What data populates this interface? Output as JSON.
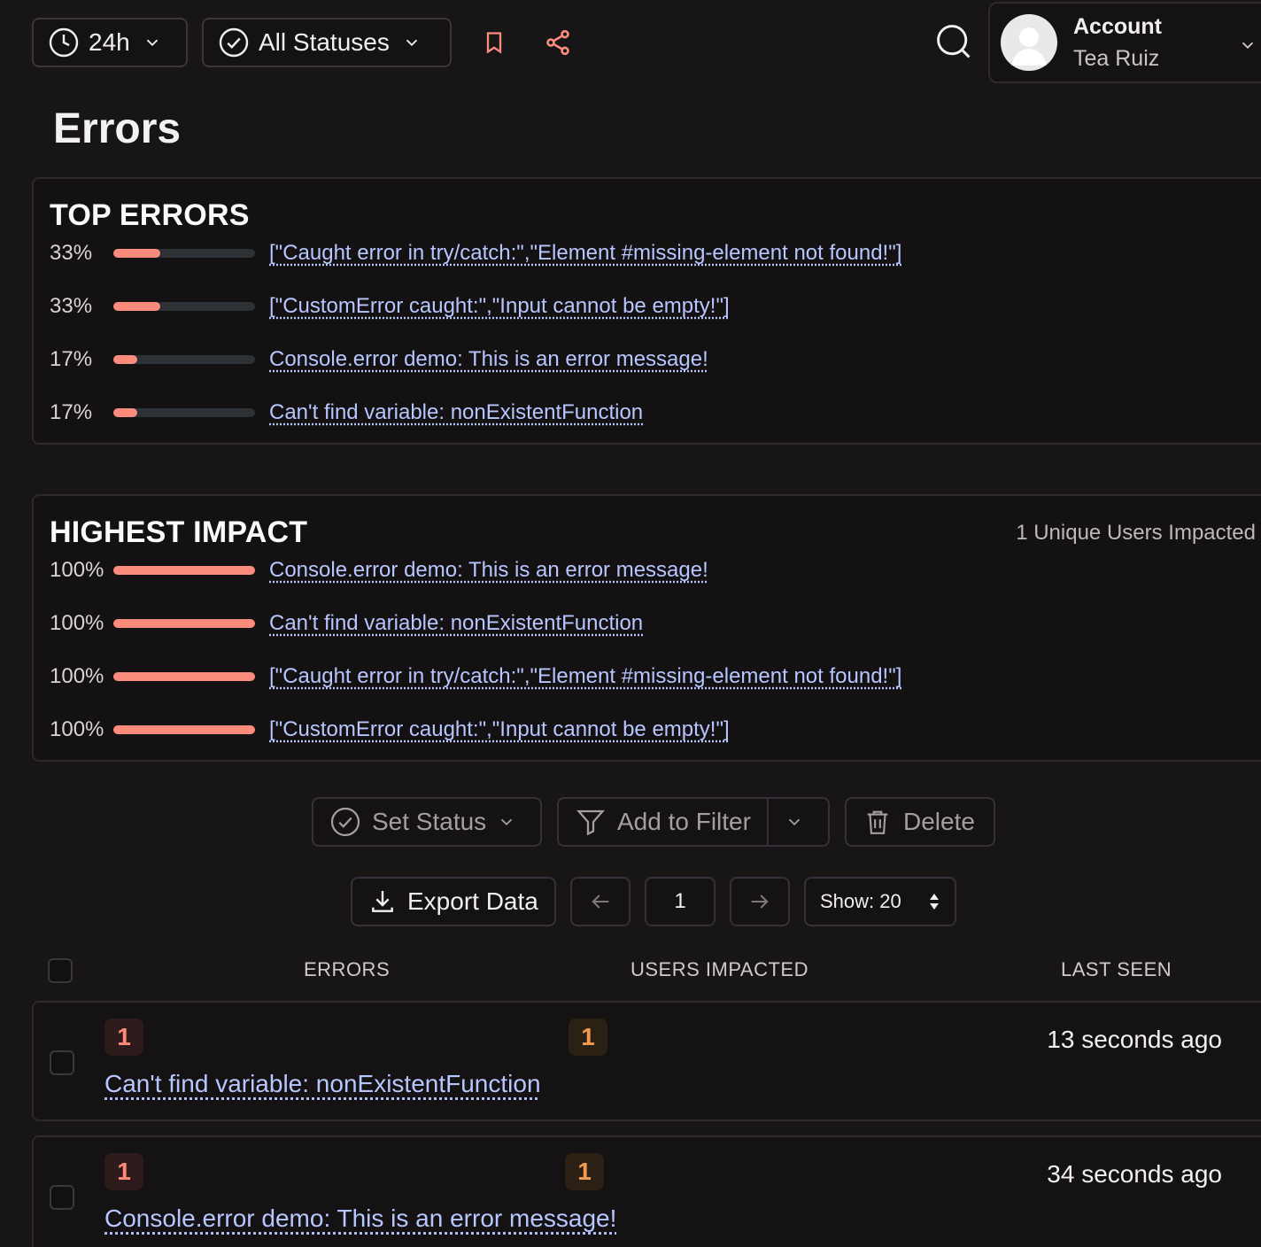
{
  "toolbar": {
    "time_range": "24h",
    "status_filter": "All Statuses"
  },
  "account": {
    "title": "Account",
    "name": "Tea Ruiz"
  },
  "page": {
    "title": "Errors"
  },
  "top_errors": {
    "title": "TOP ERRORS",
    "items": [
      {
        "pct_label": "33%",
        "pct": 0.33,
        "label": "[\"Caught error in try/catch:\",\"Element #missing-element not found!\"]"
      },
      {
        "pct_label": "33%",
        "pct": 0.33,
        "label": "[\"CustomError caught:\",\"Input cannot be empty!\"]"
      },
      {
        "pct_label": "17%",
        "pct": 0.17,
        "label": "Console.error demo: This is an error message!"
      },
      {
        "pct_label": "17%",
        "pct": 0.17,
        "label": "Can't find variable: nonExistentFunction"
      }
    ]
  },
  "highest_impact": {
    "title": "HIGHEST IMPACT",
    "note": "1 Unique Users Impacted",
    "items": [
      {
        "pct_label": "100%",
        "pct": 1.0,
        "label": "Console.error demo: This is an error message!"
      },
      {
        "pct_label": "100%",
        "pct": 1.0,
        "label": "Can't find variable: nonExistentFunction"
      },
      {
        "pct_label": "100%",
        "pct": 1.0,
        "label": "[\"Caught error in try/catch:\",\"Element #missing-element not found!\"]"
      },
      {
        "pct_label": "100%",
        "pct": 1.0,
        "label": "[\"CustomError caught:\",\"Input cannot be empty!\"]"
      }
    ]
  },
  "actions": {
    "set_status": "Set Status",
    "add_to_filter": "Add to Filter",
    "delete": "Delete",
    "export": "Export Data",
    "page": "1",
    "show": "Show: 20"
  },
  "table": {
    "headers": {
      "errors": "ERRORS",
      "users": "USERS IMPACTED",
      "last_seen": "LAST SEEN"
    },
    "rows": [
      {
        "count": "1",
        "users": "1",
        "label": "Can't find variable: nonExistentFunction",
        "last_seen": "13 seconds ago"
      },
      {
        "count": "1",
        "users": "1",
        "label": "Console.error demo: This is an error message!",
        "last_seen": "34 seconds ago"
      }
    ]
  },
  "colors": {
    "accent": "#fa8c7d",
    "link": "#b7c6ff",
    "background": "#181516"
  }
}
